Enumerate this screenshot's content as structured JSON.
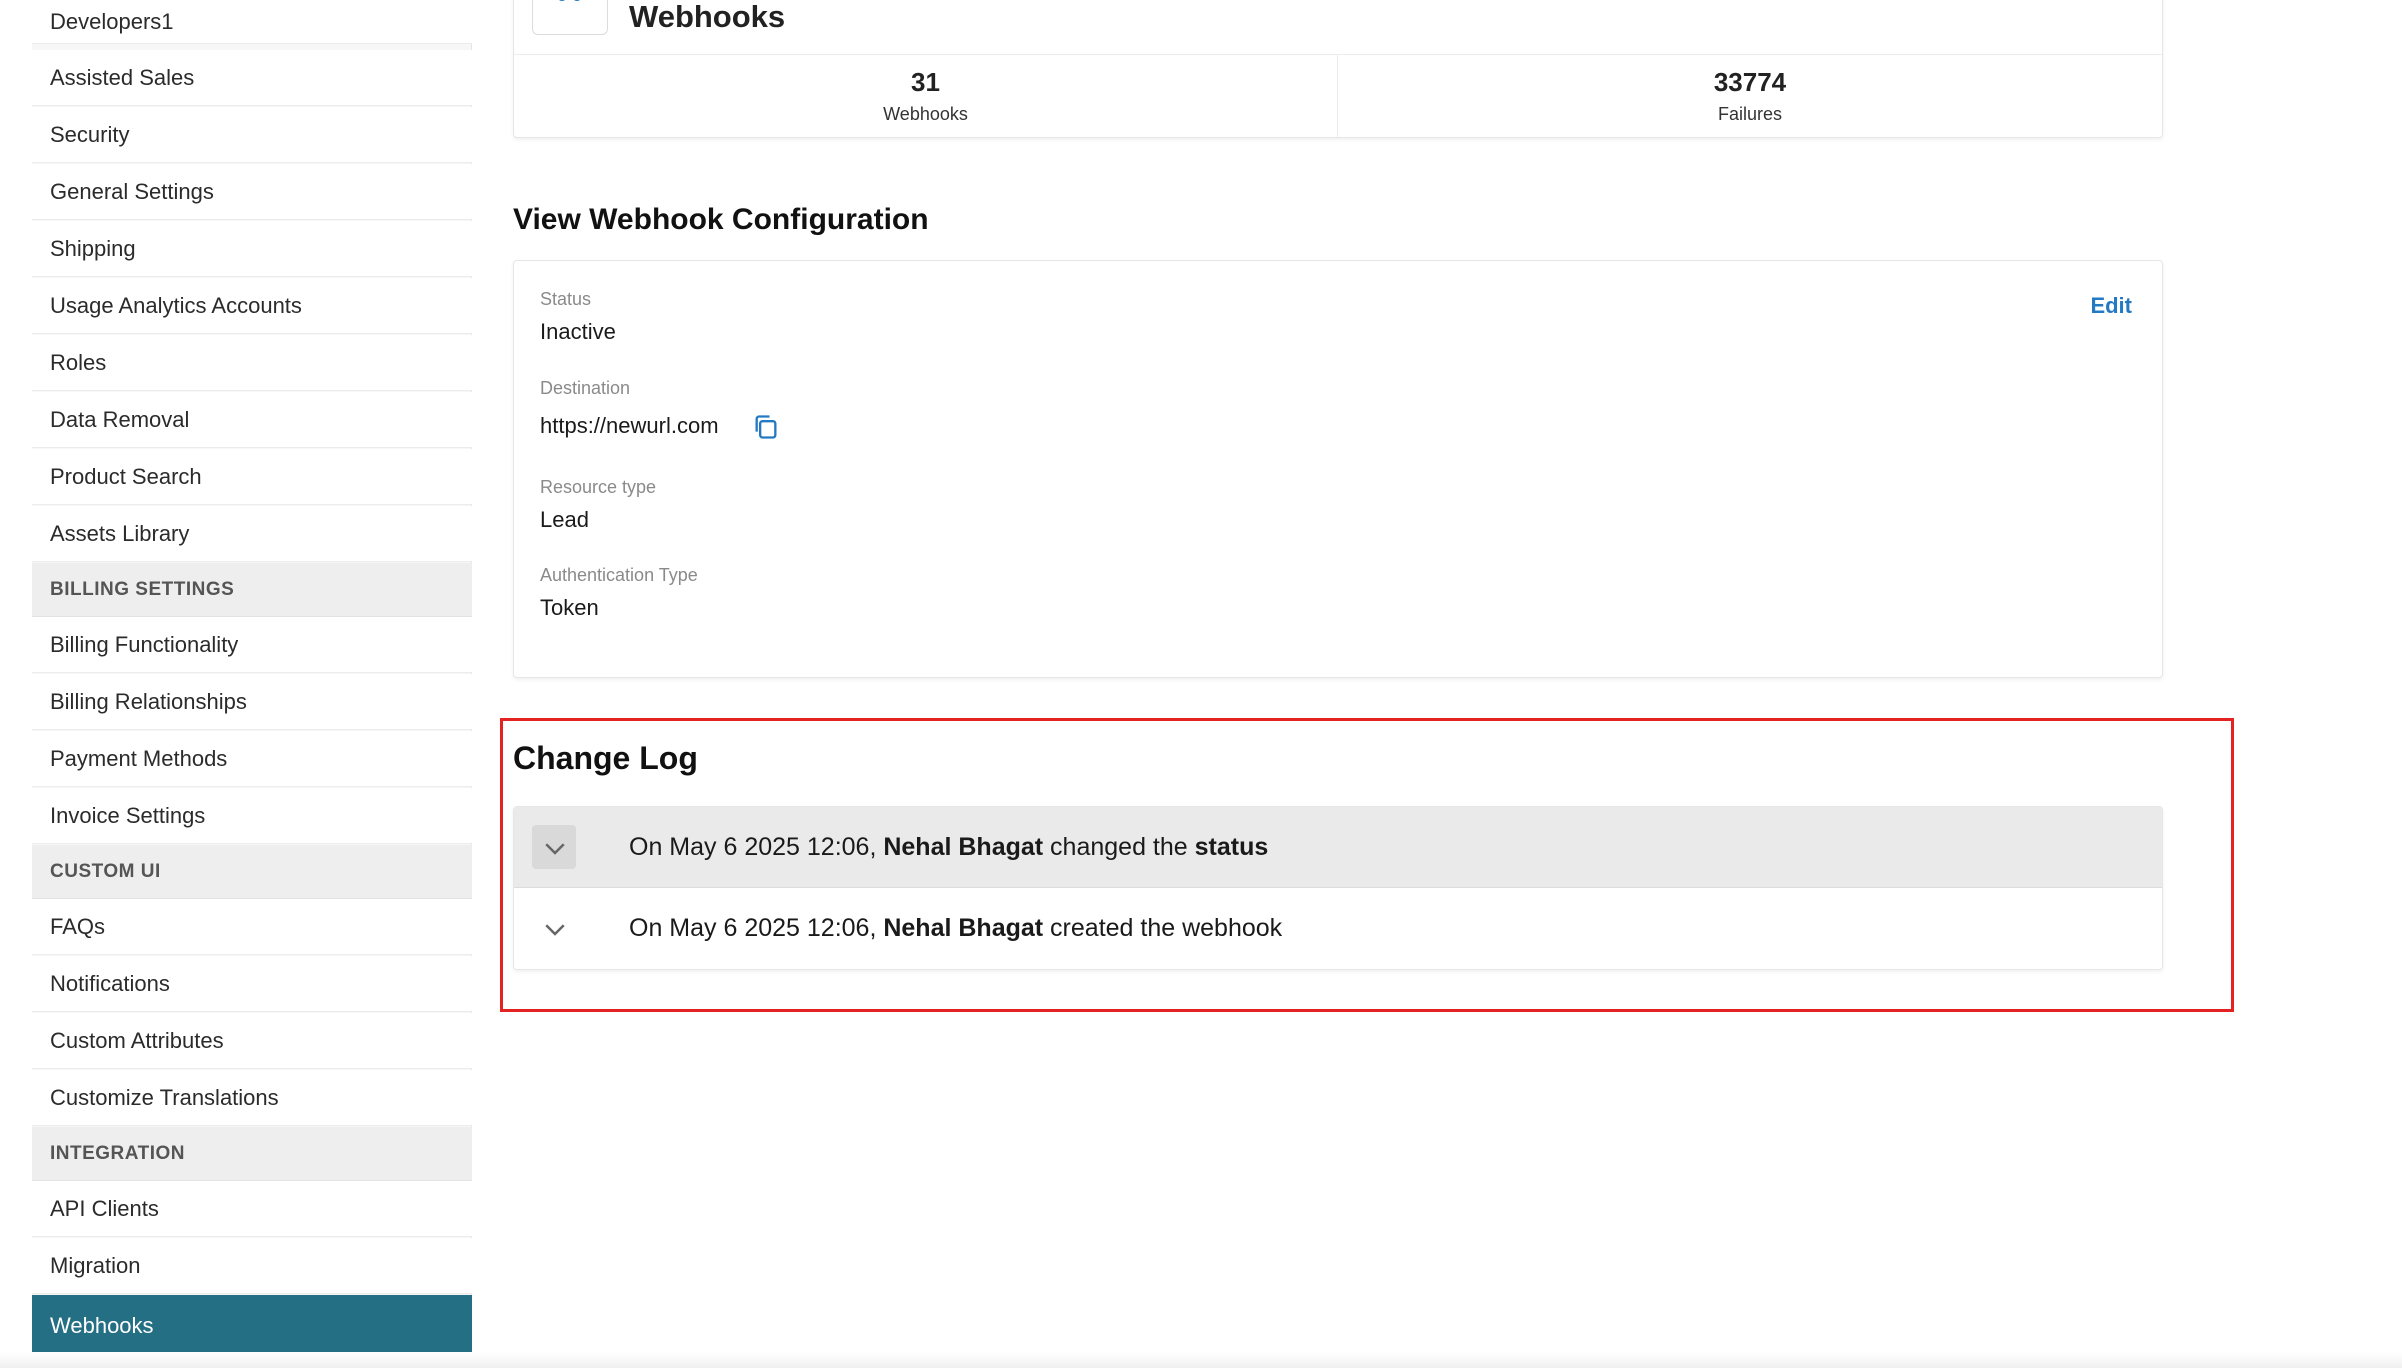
{
  "sidebar": {
    "items": [
      {
        "label": "Developers1",
        "type": "item"
      },
      {
        "label": "Assisted Sales",
        "type": "item"
      },
      {
        "label": "Security",
        "type": "item"
      },
      {
        "label": "General Settings",
        "type": "item"
      },
      {
        "label": "Shipping",
        "type": "item"
      },
      {
        "label": "Usage Analytics Accounts",
        "type": "item"
      },
      {
        "label": "Roles",
        "type": "item"
      },
      {
        "label": "Data Removal",
        "type": "item"
      },
      {
        "label": "Product Search",
        "type": "item"
      },
      {
        "label": "Assets Library",
        "type": "item"
      },
      {
        "label": "BILLING SETTINGS",
        "type": "section"
      },
      {
        "label": "Billing Functionality",
        "type": "item"
      },
      {
        "label": "Billing Relationships",
        "type": "item"
      },
      {
        "label": "Payment Methods",
        "type": "item"
      },
      {
        "label": "Invoice Settings",
        "type": "item"
      },
      {
        "label": "CUSTOM UI",
        "type": "section"
      },
      {
        "label": "FAQs",
        "type": "item"
      },
      {
        "label": "Notifications",
        "type": "item"
      },
      {
        "label": "Custom Attributes",
        "type": "item"
      },
      {
        "label": "Customize Translations",
        "type": "item"
      },
      {
        "label": "INTEGRATION",
        "type": "section"
      },
      {
        "label": "API Clients",
        "type": "item"
      },
      {
        "label": "Migration",
        "type": "item"
      },
      {
        "label": "Webhooks",
        "type": "item",
        "active": true
      }
    ]
  },
  "stats": {
    "title": "Webhooks",
    "webhooks_count": "31",
    "webhooks_label": "Webhooks",
    "failures_count": "33774",
    "failures_label": "Failures"
  },
  "config": {
    "heading": "View Webhook Configuration",
    "edit_label": "Edit",
    "status_label": "Status",
    "status_value": "Inactive",
    "destination_label": "Destination",
    "destination_value": "https://newurl.com",
    "resource_label": "Resource type",
    "resource_value": "Lead",
    "auth_label": "Authentication Type",
    "auth_value": "Token"
  },
  "changelog": {
    "heading": "Change Log",
    "entries": [
      {
        "prefix": "On May 6 2025 12:06, ",
        "user": "Nehal Bhagat",
        "action": " changed the ",
        "target": "status"
      },
      {
        "prefix": "On May 6 2025 12:06, ",
        "user": "Nehal Bhagat",
        "action": " created the webhook",
        "target": ""
      }
    ]
  },
  "colors": {
    "accent": "#2479c3",
    "sidebar_active": "#256f84",
    "highlight": "#e32222"
  },
  "icons": {
    "copy": "copy-icon",
    "chevron": "chevron-down-icon",
    "logo": "webhook-logo-icon"
  }
}
